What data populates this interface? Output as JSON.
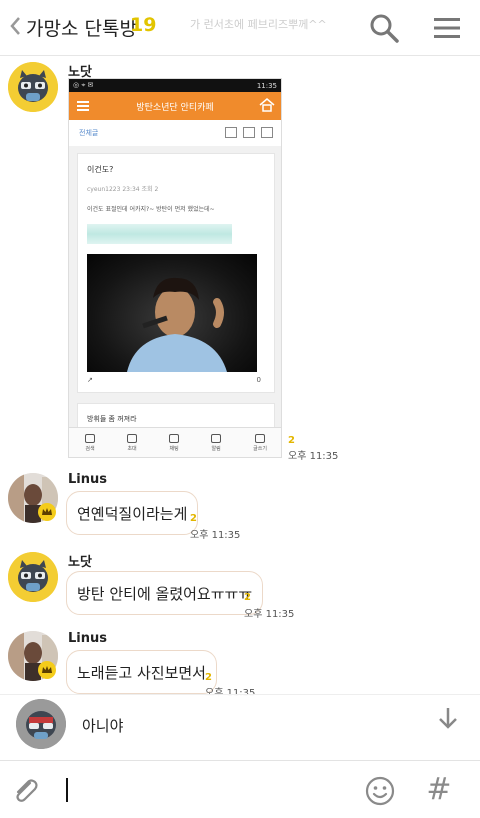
{
  "header": {
    "title": "가망소 단톡방",
    "member_count": "19",
    "ghost_notice": "가 런서초에 페브리즈뿌께^^"
  },
  "messages": [
    {
      "id": "m1",
      "sender": "노닷",
      "type": "image",
      "unread": "2",
      "time": "오후 11:35"
    },
    {
      "id": "m2",
      "sender": "Linus",
      "text": "연옌덕질이라는게",
      "unread": "2",
      "time": "오후 11:35"
    },
    {
      "id": "m3",
      "sender": "노닷",
      "text": "방탄 안티에 올렸어요ㅠㅠㅠ",
      "unread": "2",
      "time": "오후 11:35"
    },
    {
      "id": "m4",
      "sender": "Linus",
      "text": "노래듣고 사진보면서",
      "unread": "2",
      "time": "오후 11:35"
    }
  ],
  "shared_screenshot": {
    "status_time": "11:35",
    "cafe_title": "방탄소년단 안티카페",
    "board_label": "전체글",
    "post_title": "이건도?",
    "post_meta": "cyeun1223   23:34   조회 2",
    "post_body": "이건도 표절인데 어카지?~ 방탄이 먼저 했었는데~",
    "comment_count": "0",
    "next_post_title": "방휘들 좀 꺼져라",
    "tabs": [
      "검색",
      "초대",
      "채팅",
      "알림",
      "글쓰기"
    ]
  },
  "preview": {
    "text": "아니야"
  },
  "input": {
    "placeholder": ""
  },
  "colors": {
    "accent": "#e2c400",
    "cafe_orange": "#f08b2c",
    "bubble_border": "#ecd9c9"
  }
}
